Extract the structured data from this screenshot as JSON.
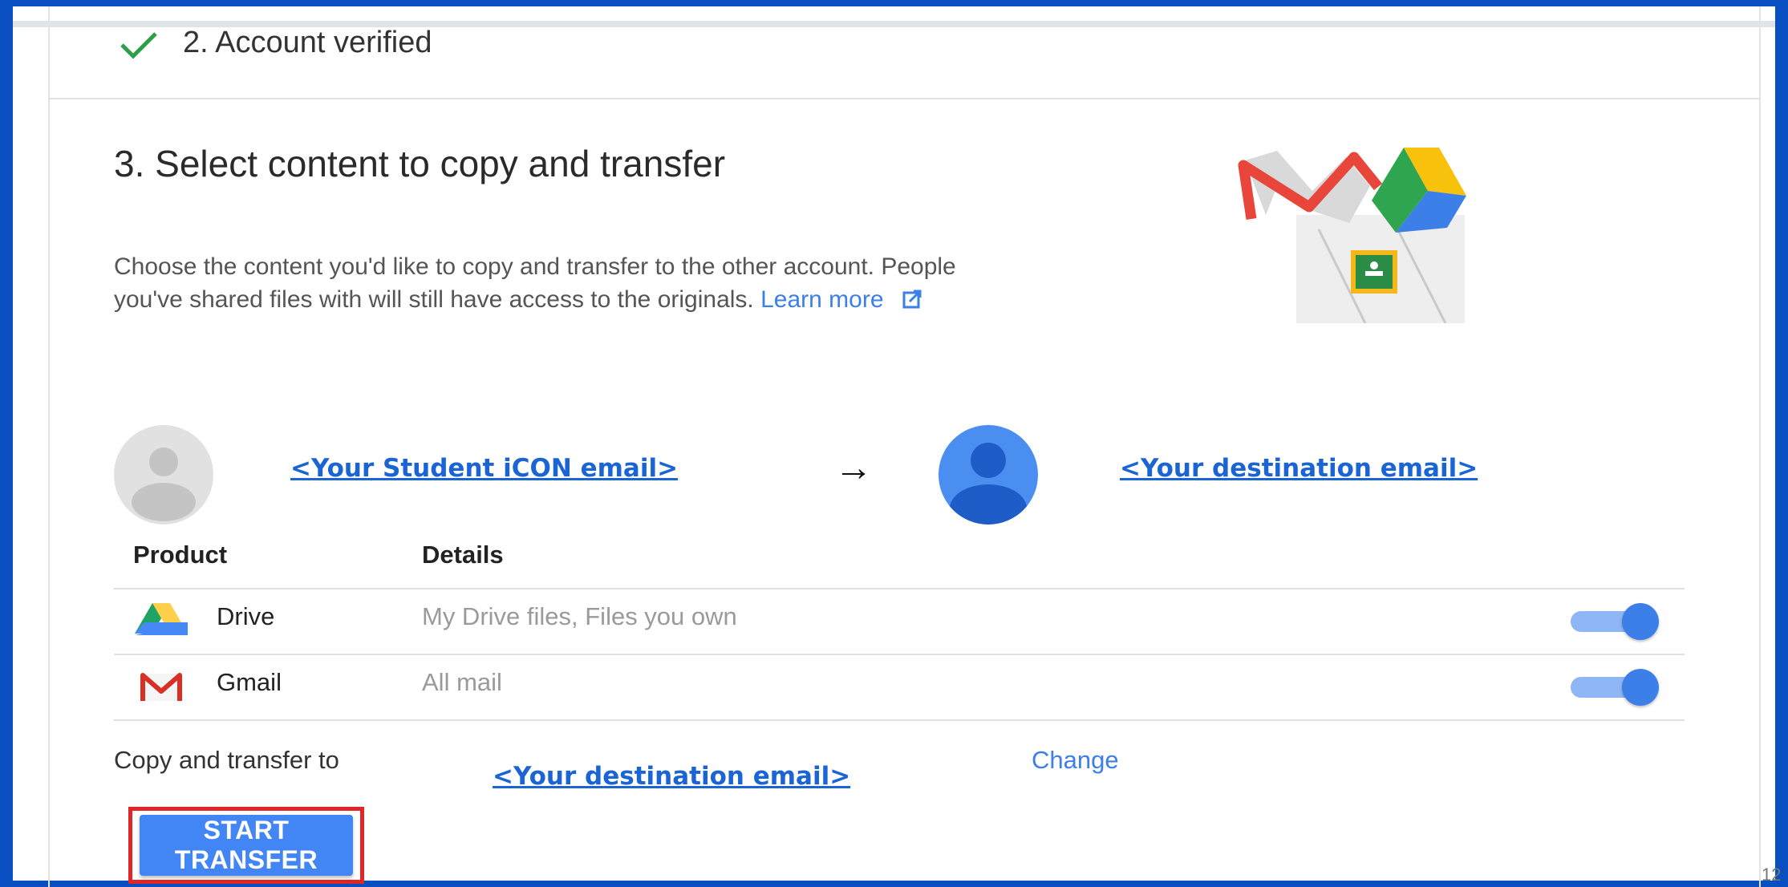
{
  "step2": {
    "label": "2. Account verified"
  },
  "step3": {
    "title": "3. Select content to copy and transfer",
    "description": "Choose the content you'd like to copy and transfer to the other account. People you've shared files with will still have access to the originals.",
    "learn_more": "Learn more"
  },
  "accounts": {
    "source_email": "<Your Student iCON email>",
    "arrow": "→",
    "destination_email": "<Your destination email>"
  },
  "table": {
    "headers": [
      "Product",
      "Details"
    ],
    "rows": [
      {
        "icon": "drive-icon",
        "product": "Drive",
        "details": "My Drive files, Files you own",
        "enabled": true
      },
      {
        "icon": "gmail-icon",
        "product": "Gmail",
        "details": "All mail",
        "enabled": true
      }
    ]
  },
  "transfer": {
    "label": "Copy and transfer to",
    "email": "<Your destination email>",
    "change_label": "Change",
    "start_label": "START TRANSFER"
  },
  "page_number": "12",
  "colors": {
    "accent": "#4285f4",
    "link": "#1a64d6",
    "frame": "#0a4fc2",
    "highlight": "#e02626"
  }
}
